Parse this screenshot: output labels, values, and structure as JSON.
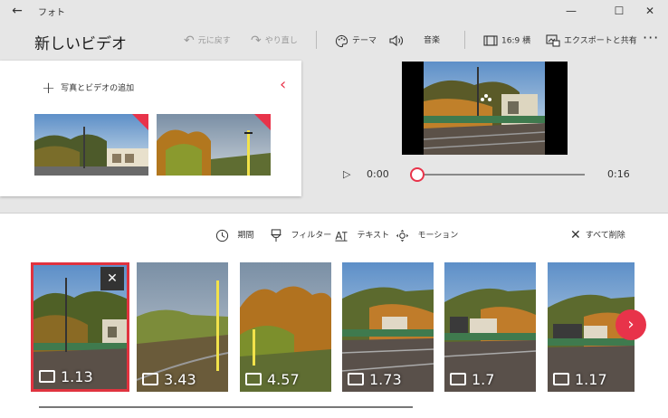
{
  "app": {
    "title": "フォト"
  },
  "window": {
    "minimize": "—",
    "maximize": "☐",
    "close": "✕"
  },
  "header": {
    "title": "新しいビデオ",
    "undo_label": "元に戻す",
    "redo_label": "やり直し",
    "theme_label": "テーマ",
    "music_label": "音楽",
    "aspect_label": "16:9 横",
    "export_label": "エクスポートと共有"
  },
  "library": {
    "add_label": "写真とビデオの追加"
  },
  "player": {
    "current_time": "0:00",
    "total_time": "0:16",
    "progress": 0
  },
  "storyboard_toolbar": {
    "duration_label": "期間",
    "filter_label": "フィルター",
    "text_label": "テキスト",
    "motion_label": "モーション",
    "remove_all_label": "すべて削除"
  },
  "clips": [
    {
      "duration": "1.13",
      "selected": true
    },
    {
      "duration": "3.43"
    },
    {
      "duration": "4.57"
    },
    {
      "duration": "1.73"
    },
    {
      "duration": "1.7"
    },
    {
      "duration": "1.17"
    }
  ],
  "colors": {
    "accent": "#e8334a",
    "selection": "#e0333f"
  }
}
